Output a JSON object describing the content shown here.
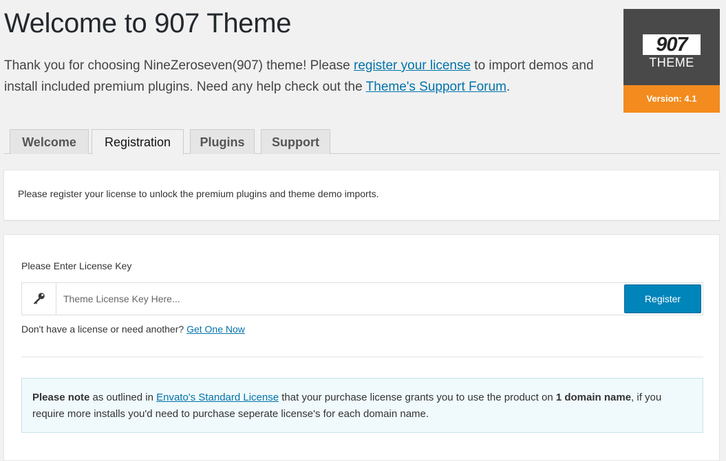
{
  "header": {
    "title": "Welcome to 907 Theme",
    "intro_part1": "Thank you for choosing NineZeroseven(907) theme! Please ",
    "intro_link1": "register your license",
    "intro_part2": " to import demos and install included premium plugins. Need any help check out the ",
    "intro_link2": "Theme's Support Forum",
    "intro_part3": "."
  },
  "badge": {
    "logo_text": "907",
    "theme_text": "THEME",
    "version_text": "Version: 4.1",
    "bg_color": "#494949",
    "version_color": "#f38b1f"
  },
  "tabs": [
    {
      "label": "Welcome",
      "active": false
    },
    {
      "label": "Registration",
      "active": true
    },
    {
      "label": "Plugins",
      "active": false
    },
    {
      "label": "Support",
      "active": false
    }
  ],
  "info_card": {
    "text": "Please register your license to unlock the premium plugins and theme demo imports."
  },
  "license": {
    "label": "Please Enter License Key",
    "icon": "key-icon",
    "placeholder": "Theme License Key Here...",
    "value": "",
    "register_label": "Register",
    "no_license_text": "Don't have a license or need another? ",
    "get_one_link": "Get One Now",
    "accent_color": "#0085ba"
  },
  "notice": {
    "bold1": "Please note",
    "text1": " as outlined in ",
    "link": "Envato's Standard License",
    "text2": " that your purchase license grants you to use the product on ",
    "bold2": "1 domain name",
    "text3": ", if you require more installs you'd need to purchase seperate license's for each domain name."
  }
}
